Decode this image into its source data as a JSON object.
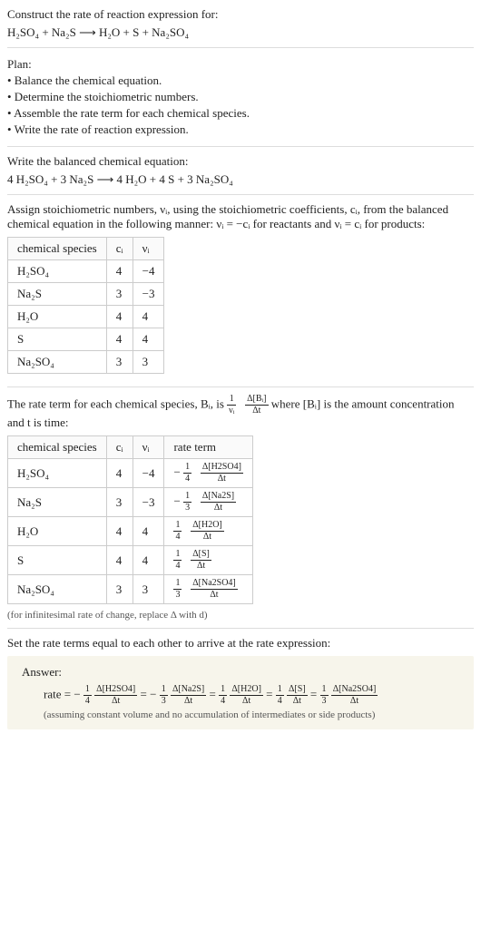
{
  "q_title": "Construct the rate of reaction expression for:",
  "q_eq": "H₂SO₄ + Na₂S ⟶ H₂O + S + Na₂SO₄",
  "plan_title": "Plan:",
  "plan_items": [
    "• Balance the chemical equation.",
    "• Determine the stoichiometric numbers.",
    "• Assemble the rate term for each chemical species.",
    "• Write the rate of reaction expression."
  ],
  "bal_title": "Write the balanced chemical equation:",
  "bal_eq": "4 H₂SO₄ + 3 Na₂S ⟶ 4 H₂O + 4 S + 3 Na₂SO₄",
  "stoich_intro1": "Assign stoichiometric numbers, νᵢ, using the stoichiometric coefficients, cᵢ, from the balanced chemical equation in the following manner: νᵢ = −cᵢ for reactants and νᵢ = cᵢ for products:",
  "table1": {
    "h": [
      "chemical species",
      "cᵢ",
      "νᵢ"
    ],
    "r": [
      [
        "H₂SO₄",
        "4",
        "−4"
      ],
      [
        "Na₂S",
        "3",
        "−3"
      ],
      [
        "H₂O",
        "4",
        "4"
      ],
      [
        "S",
        "4",
        "4"
      ],
      [
        "Na₂SO₄",
        "3",
        "3"
      ]
    ]
  },
  "rate_intro_a": "The rate term for each chemical species, Bᵢ, is ",
  "rate_intro_b": " where [Bᵢ] is the amount concentration and t is time:",
  "frac_1_nu": {
    "num": "1",
    "den": "νᵢ"
  },
  "frac_dB": {
    "num": "Δ[Bᵢ]",
    "den": "Δt"
  },
  "table2": {
    "h": [
      "chemical species",
      "cᵢ",
      "νᵢ",
      "rate term"
    ],
    "r": [
      {
        "sp": "H₂SO₄",
        "c": "4",
        "n": "−4",
        "sign": "−",
        "f1": {
          "num": "1",
          "den": "4"
        },
        "f2": {
          "num": "Δ[H2SO4]",
          "den": "Δt"
        }
      },
      {
        "sp": "Na₂S",
        "c": "3",
        "n": "−3",
        "sign": "−",
        "f1": {
          "num": "1",
          "den": "3"
        },
        "f2": {
          "num": "Δ[Na2S]",
          "den": "Δt"
        }
      },
      {
        "sp": "H₂O",
        "c": "4",
        "n": "4",
        "sign": "",
        "f1": {
          "num": "1",
          "den": "4"
        },
        "f2": {
          "num": "Δ[H2O]",
          "den": "Δt"
        }
      },
      {
        "sp": "S",
        "c": "4",
        "n": "4",
        "sign": "",
        "f1": {
          "num": "1",
          "den": "4"
        },
        "f2": {
          "num": "Δ[S]",
          "den": "Δt"
        }
      },
      {
        "sp": "Na₂SO₄",
        "c": "3",
        "n": "3",
        "sign": "",
        "f1": {
          "num": "1",
          "den": "3"
        },
        "f2": {
          "num": "Δ[Na2SO4]",
          "den": "Δt"
        }
      }
    ]
  },
  "inf_note": "(for infinitesimal rate of change, replace Δ with d)",
  "set_title": "Set the rate terms equal to each other to arrive at the rate expression:",
  "answer_label": "Answer:",
  "rate_prefix": "rate = ",
  "eq_parts": [
    {
      "sign": "−",
      "f1": {
        "num": "1",
        "den": "4"
      },
      "f2": {
        "num": "Δ[H2SO4]",
        "den": "Δt"
      }
    },
    {
      "sign": "−",
      "f1": {
        "num": "1",
        "den": "3"
      },
      "f2": {
        "num": "Δ[Na2S]",
        "den": "Δt"
      }
    },
    {
      "sign": "",
      "f1": {
        "num": "1",
        "den": "4"
      },
      "f2": {
        "num": "Δ[H2O]",
        "den": "Δt"
      }
    },
    {
      "sign": "",
      "f1": {
        "num": "1",
        "den": "4"
      },
      "f2": {
        "num": "Δ[S]",
        "den": "Δt"
      }
    },
    {
      "sign": "",
      "f1": {
        "num": "1",
        "den": "3"
      },
      "f2": {
        "num": "Δ[Na2SO4]",
        "den": "Δt"
      }
    }
  ],
  "answer_note": "(assuming constant volume and no accumulation of intermediates or side products)"
}
